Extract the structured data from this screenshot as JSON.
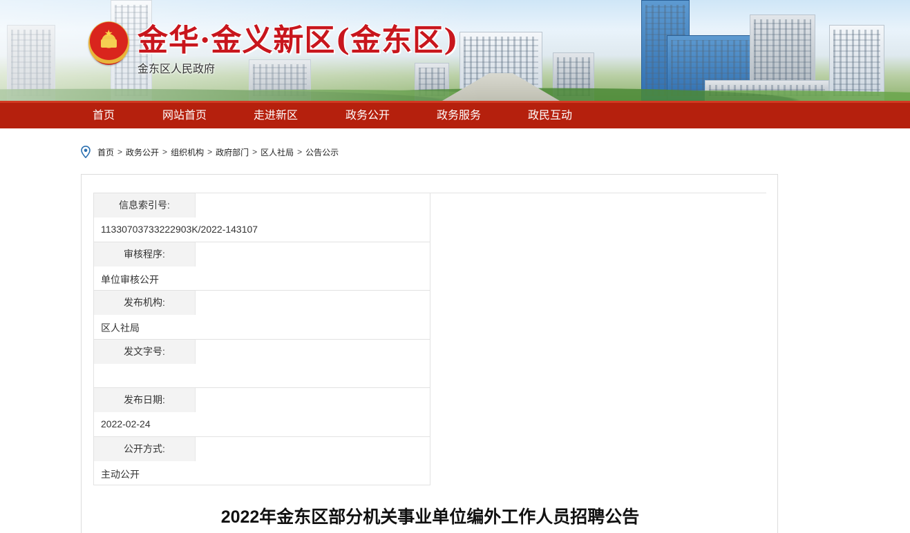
{
  "header": {
    "title": "金华·金义新区(金东区)",
    "subtitle": "金东区人民政府",
    "emblem_icon": "national-emblem-icon"
  },
  "nav": {
    "items": [
      {
        "label": "首页"
      },
      {
        "label": "网站首页"
      },
      {
        "label": "走进新区"
      },
      {
        "label": "政务公开"
      },
      {
        "label": "政务服务"
      },
      {
        "label": "政民互动"
      }
    ]
  },
  "breadcrumb": {
    "icon": "location-pin-icon",
    "items": [
      "首页",
      "政务公开",
      "组织机构",
      "政府部门",
      "区人社局",
      "公告公示"
    ],
    "separator": ">"
  },
  "meta": {
    "rows": [
      {
        "label": "信息索引号:",
        "value": "11330703733222903K/2022-143107"
      },
      {
        "label": "审核程序:",
        "value": "单位审核公开"
      },
      {
        "label": "发布机构:",
        "value": "区人社局"
      },
      {
        "label": "发文字号:",
        "value": ""
      },
      {
        "label": "发布日期:",
        "value": "2022-02-24"
      },
      {
        "label": "公开方式:",
        "value": "主动公开"
      }
    ]
  },
  "article": {
    "title": "2022年金东区部分机关事业单位编外工作人员招聘公告"
  },
  "colors": {
    "nav_background": "#b5200d",
    "title_red": "#c8161d",
    "label_background": "#f3f3f3"
  }
}
